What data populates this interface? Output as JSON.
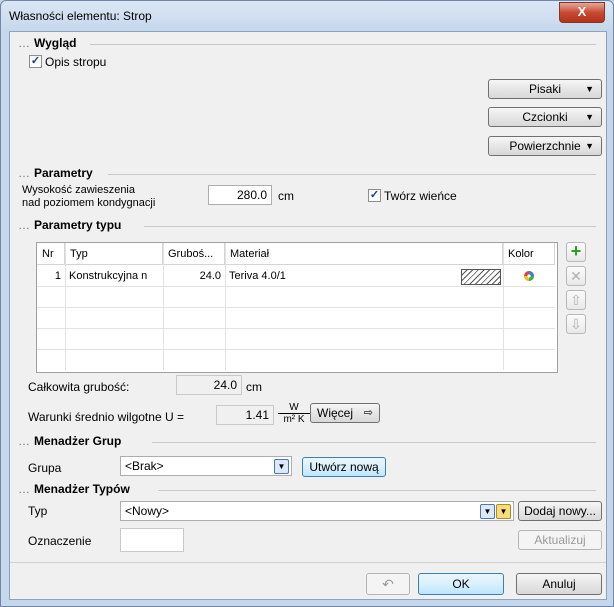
{
  "window": {
    "title": "Własności elementu: Strop",
    "close_label": "X"
  },
  "appearance": {
    "section_label": "Wygląd",
    "opis_checkbox_label": "Opis stropu",
    "opis_checked": true,
    "buttons": {
      "pens": "Pisaki",
      "fonts": "Czcionki",
      "surfaces": "Powierzchnie"
    }
  },
  "parameters": {
    "section_label": "Parametry",
    "height_label_line1": "Wysokość zawieszenia",
    "height_label_line2": "nad poziomem kondygnacji",
    "height_value": "280.0",
    "height_unit": "cm",
    "wreath_label": "Twórz wieńce",
    "wreath_checked": true
  },
  "type_params": {
    "section_label": "Parametry typu",
    "columns": [
      "Nr",
      "Typ",
      "Gruboś...",
      "Materiał",
      "Kolor"
    ],
    "rows": [
      {
        "nr": "1",
        "type": "Konstrukcyjna n",
        "thickness": "24.0",
        "material": "Teriva 4.0/1"
      }
    ],
    "total_label": "Całkowita grubość:",
    "total_value": "24.0",
    "total_unit": "cm",
    "u_label": "Warunki średnio wilgotne U =",
    "u_value": "1.41",
    "u_unit_num": "W",
    "u_unit_den": "m² K",
    "more_button": "Więcej"
  },
  "group_manager": {
    "section_label": "Menadżer Grup",
    "group_label": "Grupa",
    "group_value": "<Brak>",
    "create_button": "Utwórz nową"
  },
  "type_manager": {
    "section_label": "Menadżer Typów",
    "type_label": "Typ",
    "type_value": "<Nowy>",
    "add_button": "Dodaj nowy...",
    "designation_label": "Oznaczenie",
    "designation_value": "",
    "update_button": "Aktualizuj"
  },
  "footer": {
    "ok": "OK",
    "cancel": "Anuluj"
  },
  "colors": {
    "accent_green": "#2e9e2e",
    "blue_button": "#bee6fd",
    "title_bg": "#c6d7ec"
  }
}
